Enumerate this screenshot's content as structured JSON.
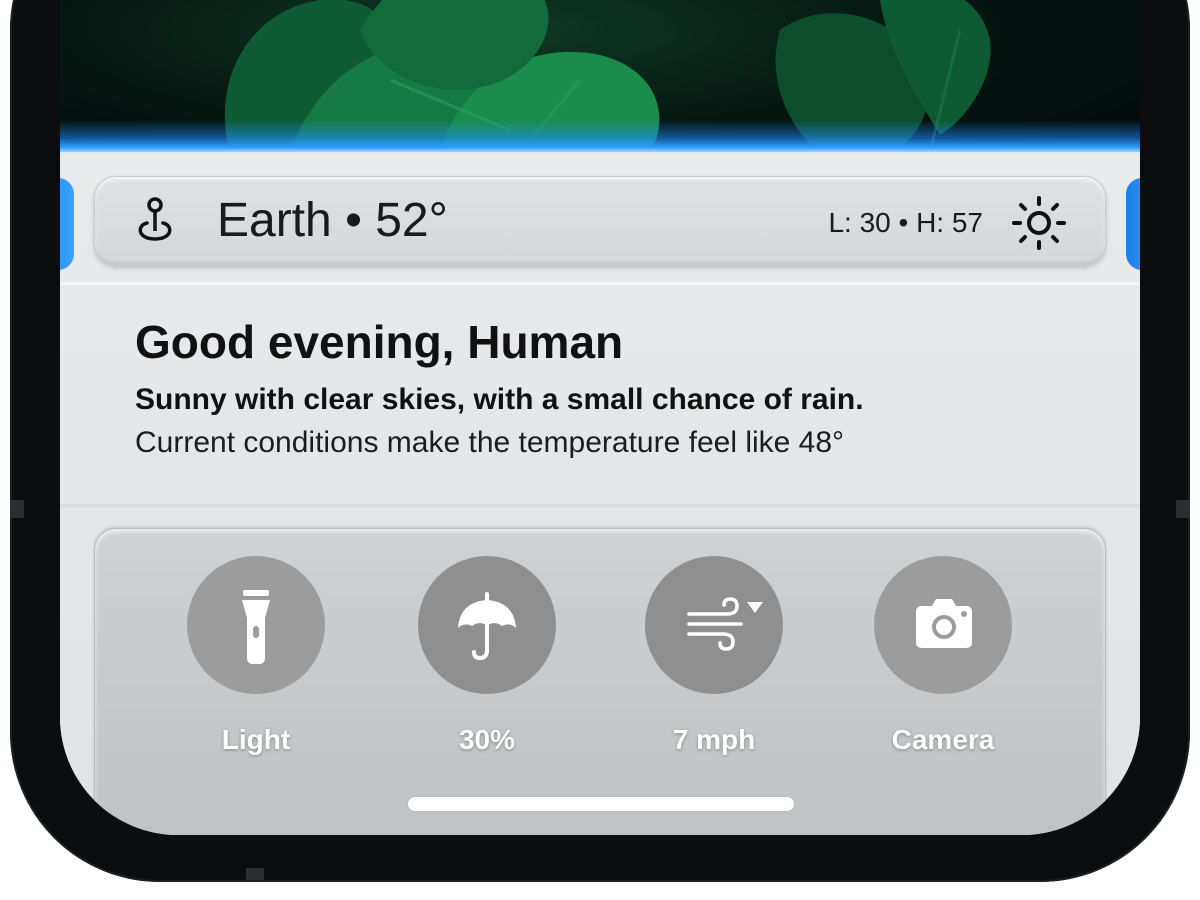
{
  "weather": {
    "location": "Earth",
    "temperature": "52°",
    "location_line": "Earth • 52°",
    "low_high": "L: 30 • H: 57",
    "icon": "sun-icon"
  },
  "greeting": {
    "title": "Good evening, Human",
    "summary": "Sunny with clear skies, with a small chance of rain.",
    "detail": "Current conditions make the temperature feel like 48°"
  },
  "controls": [
    {
      "label": "Light",
      "icon": "flashlight-icon"
    },
    {
      "label": "30%",
      "icon": "umbrella-icon"
    },
    {
      "label": "7 mph",
      "icon": "wind-icon"
    },
    {
      "label": "Camera",
      "icon": "camera-icon"
    }
  ],
  "colors": {
    "accent_glow": "#2a9cff",
    "control_circle": "#9c9c9c"
  }
}
